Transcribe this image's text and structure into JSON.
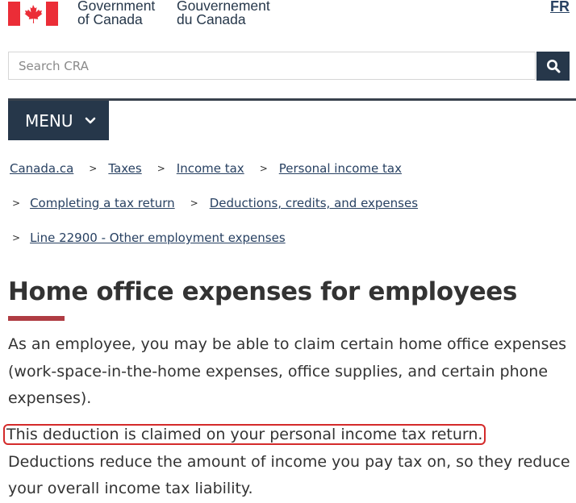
{
  "header": {
    "brand_en_line1": "Government",
    "brand_en_line2": "of Canada",
    "brand_fr_line1": "Gouvernement",
    "brand_fr_line2": "du Canada",
    "language_toggle": "FR"
  },
  "search": {
    "placeholder": "Search CRA",
    "button_icon": "search-icon"
  },
  "menu": {
    "label": "MENU",
    "icon": "chevron-down-icon"
  },
  "breadcrumbs": [
    "Canada.ca",
    "Taxes",
    "Income tax",
    "Personal income tax",
    "Completing a tax return",
    "Deductions, credits, and expenses",
    "Line 22900 - Other employment expenses"
  ],
  "page": {
    "title": "Home office expenses for employees",
    "intro": "As an employee, you may be able to claim certain home office expenses (work-space-in-the-home expenses, office supplies, and certain phone expenses).",
    "highlighted_sentence": "This deduction is claimed on your personal income tax return.",
    "continuation": " Deductions reduce the amount of income you pay tax on, so they reduce your overall income tax liability."
  },
  "colors": {
    "brand_navy": "#26374a",
    "link": "#284162",
    "flag_red": "#eb2d37",
    "title_accent": "#af3c43",
    "highlight_outline": "#d42a2a"
  }
}
